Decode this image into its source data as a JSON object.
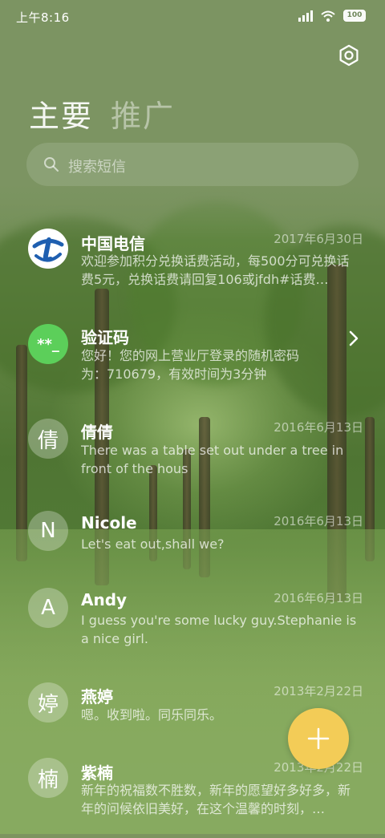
{
  "status_bar": {
    "time": "上午8:16",
    "battery": "100"
  },
  "tabs": [
    {
      "label": "主要",
      "active": true
    },
    {
      "label": "推广",
      "active": false
    }
  ],
  "search": {
    "placeholder": "搜索短信"
  },
  "conversations": [
    {
      "name": "中国电信",
      "date": "2017年6月30日",
      "avatar": "telecom-logo",
      "snippet": "欢迎参加积分兑换话费活动，每500分可兑换话费5元，兑换话费请回复106或jfdh#话费…"
    },
    {
      "name": "验证码",
      "date": "",
      "avatar": "**_",
      "snippet": "您好！您的网上营业厅登录的随机密码为：710679，有效时间为3分钟"
    },
    {
      "name": "倩倩",
      "date": "2016年6月13日",
      "avatar": "倩",
      "snippet": "There was a table set out under a tree in front of the hous"
    },
    {
      "name": "Nicole",
      "date": "2016年6月13日",
      "avatar": "N",
      "snippet": "Let's eat out,shall we?"
    },
    {
      "name": "Andy",
      "date": "2016年6月13日",
      "avatar": "A",
      "snippet": "I guess you're some lucky guy.Stephanie is a nice girl."
    },
    {
      "name": "燕婷",
      "date": "2013年2月22日",
      "avatar": "婷",
      "snippet": "嗯。收到啦。同乐同乐。"
    },
    {
      "name": "紫楠",
      "date": "2013年2月22日",
      "avatar": "楠",
      "snippet": "新年的祝福数不胜数，新年的愿望好多好多，新年的问候依旧美好，在这个温馨的时刻，…"
    }
  ],
  "colors": {
    "accent_fab": "#f3cc57",
    "telecom_blue": "#1f5fb0",
    "verify_green": "#5ccf5a"
  }
}
